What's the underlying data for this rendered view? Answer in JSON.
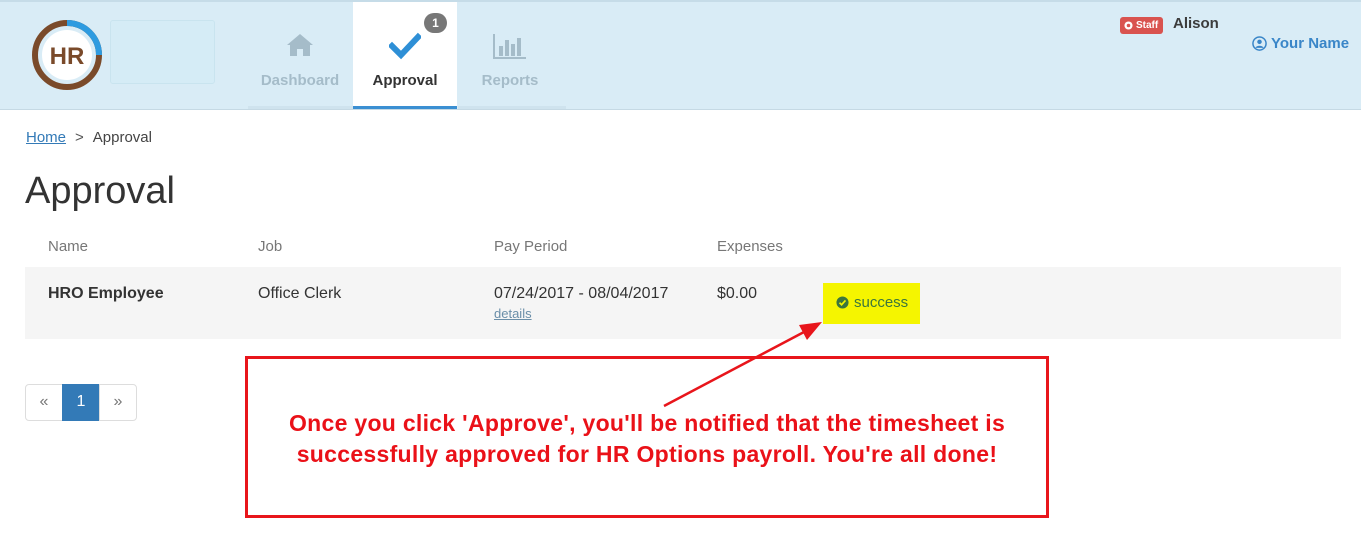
{
  "header": {
    "logo_text": "HR",
    "nav": [
      {
        "label": "Dashboard",
        "icon": "home-icon"
      },
      {
        "label": "Approval",
        "icon": "checkmark-icon",
        "badge": "1",
        "active": true
      },
      {
        "label": "Reports",
        "icon": "bar-chart-icon"
      }
    ],
    "staff_badge": "Staff",
    "staff_user": "Alison",
    "user_menu": "Your Name"
  },
  "breadcrumb": {
    "home": "Home",
    "separator": ">",
    "current": "Approval"
  },
  "page_title": "Approval",
  "table": {
    "columns": [
      "Name",
      "Job",
      "Pay Period",
      "Expenses"
    ],
    "rows": [
      {
        "name": "HRO Employee",
        "job": "Office Clerk",
        "pay_period": "07/24/2017 - 08/04/2017",
        "details_link": "details",
        "expenses": "$0.00",
        "status": "success"
      }
    ]
  },
  "pagination": {
    "prev": "«",
    "page": "1",
    "next": "»"
  },
  "annotation": {
    "text": "Once you click 'Approve', you'll be notified that the timesheet is successfully approved for HR Options payroll. You're all done!",
    "color": "#ea1118"
  },
  "colors": {
    "header_bg": "#d9ecf6",
    "accent": "#337ab7",
    "highlight": "#f5f500",
    "success": "#3c763d",
    "danger": "#d9534f"
  }
}
